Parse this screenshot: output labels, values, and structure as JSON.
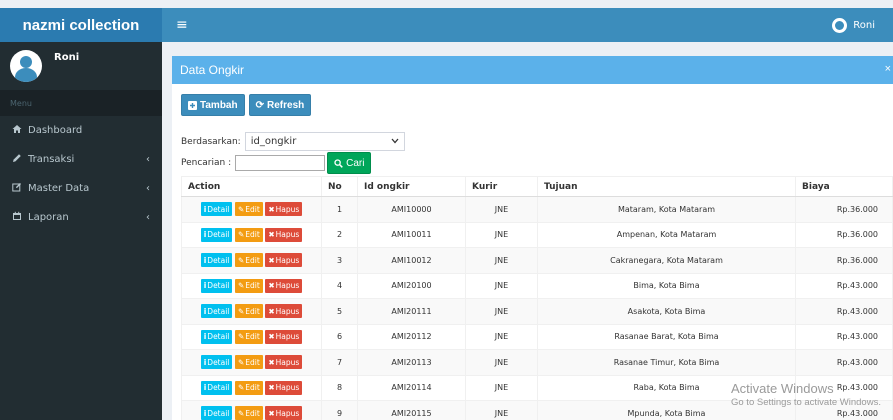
{
  "header": {
    "logo": "nazmi collection",
    "menu_toggle": "≡",
    "user": "Roni"
  },
  "sidebar": {
    "user": "Roni",
    "menu_header": "Menu",
    "items": [
      {
        "icon": "home-icon",
        "label": "Dashboard",
        "chevron": ""
      },
      {
        "icon": "pencil-icon",
        "label": "Transaksi",
        "chevron": "‹"
      },
      {
        "icon": "edit-icon",
        "label": "Master Data",
        "chevron": "‹"
      },
      {
        "icon": "calendar-icon",
        "label": "Laporan",
        "chevron": "‹"
      }
    ]
  },
  "box": {
    "title": "Data Ongkir",
    "close": "×",
    "add_label": "Tambah",
    "refresh_label": "Refresh",
    "filter_label": "Berdasarkan:",
    "filter_value": "id_ongkir",
    "search_label": "Pencarian :",
    "search_value": "",
    "search_button": "Cari"
  },
  "table": {
    "columns": [
      "Action",
      "No",
      "Id ongkir",
      "Kurir",
      "Tujuan",
      "Biaya"
    ],
    "actions": {
      "detail": "Detail",
      "edit": "Edit",
      "hapus": "Hapus"
    },
    "rows": [
      {
        "no": "1",
        "id": "AMI10000",
        "kurir": "JNE",
        "tujuan": "Mataram, Kota Mataram",
        "biaya": "Rp.36.000"
      },
      {
        "no": "2",
        "id": "AMI10011",
        "kurir": "JNE",
        "tujuan": "Ampenan, Kota Mataram",
        "biaya": "Rp.36.000"
      },
      {
        "no": "3",
        "id": "AMI10012",
        "kurir": "JNE",
        "tujuan": "Cakranegara, Kota Mataram",
        "biaya": "Rp.36.000"
      },
      {
        "no": "4",
        "id": "AMI20100",
        "kurir": "JNE",
        "tujuan": "Bima, Kota Bima",
        "biaya": "Rp.43.000"
      },
      {
        "no": "5",
        "id": "AMI20111",
        "kurir": "JNE",
        "tujuan": "Asakota, Kota Bima",
        "biaya": "Rp.43.000"
      },
      {
        "no": "6",
        "id": "AMI20112",
        "kurir": "JNE",
        "tujuan": "Rasanae Barat, Kota Bima",
        "biaya": "Rp.43.000"
      },
      {
        "no": "7",
        "id": "AMI20113",
        "kurir": "JNE",
        "tujuan": "Rasanae Timur, Kota Bima",
        "biaya": "Rp.43.000"
      },
      {
        "no": "8",
        "id": "AMI20114",
        "kurir": "JNE",
        "tujuan": "Raba, Kota Bima",
        "biaya": "Rp.43.000"
      },
      {
        "no": "9",
        "id": "AMI20115",
        "kurir": "JNE",
        "tujuan": "Mpunda, Kota Bima",
        "biaya": "Rp.43.000"
      }
    ]
  },
  "watermark": {
    "line1": "Activate Windows",
    "line2": "Go to Settings to activate Windows."
  }
}
